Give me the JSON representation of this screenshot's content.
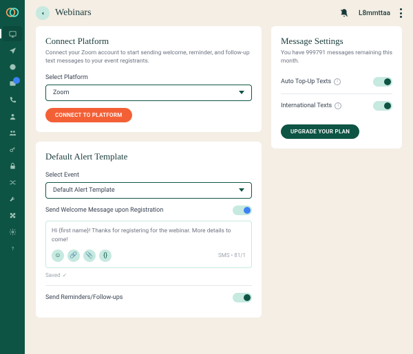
{
  "header": {
    "title": "Webinars",
    "user": "L8mmttaa"
  },
  "connect": {
    "title": "Connect Platform",
    "subtitle": "Connect your Zoom account to start sending welcome, reminder, and follow-up text messages to your event registrants.",
    "selectLabel": "Select Platform",
    "selectValue": "Zoom",
    "button": "CONNECT TO PLATFORM"
  },
  "template": {
    "title": "Default Alert Template",
    "eventLabel": "Select Event",
    "eventValue": "Default Alert Template",
    "welcomeToggleLabel": "Send Welcome Message upon Registration",
    "welcomeMessage": "Hi {first name}! Thanks for registering for the webinar. More details to come!",
    "charCount": "SMS • 81/1",
    "saved": "Saved",
    "remindersLabel": "Send Reminders/Follow-ups"
  },
  "settings": {
    "title": "Message Settings",
    "subtitle": "You have 999791 messages remaining this month.",
    "autoTopup": "Auto Top-Up Texts",
    "international": "International Texts",
    "upgrade": "UPGRADE YOUR PLAN"
  }
}
